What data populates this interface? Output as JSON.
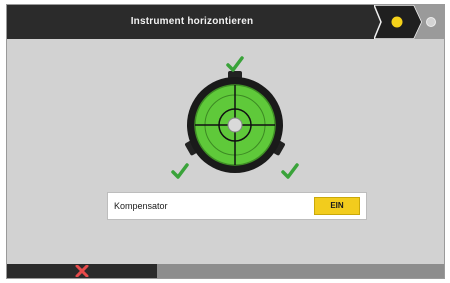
{
  "header": {
    "title": "Instrument horizontieren",
    "steps": [
      {
        "state": "current",
        "color": "#f5d21a"
      },
      {
        "state": "pending",
        "color": "#cfcfcf"
      }
    ]
  },
  "level": {
    "status": "leveled",
    "bubble_color": "#5fc93a",
    "checkmarks": [
      "check-icon",
      "check-icon",
      "check-icon"
    ]
  },
  "compensator": {
    "label": "Kompensator",
    "toggle_label": "EIN"
  },
  "footer": {
    "cancel_icon": "close-icon",
    "cancel_color": "#e84b4b"
  },
  "colors": {
    "header_bg": "#2b2b2b",
    "screen_bg": "#d2d2d2",
    "accent": "#f2cc1d",
    "check": "#3aa33a"
  }
}
